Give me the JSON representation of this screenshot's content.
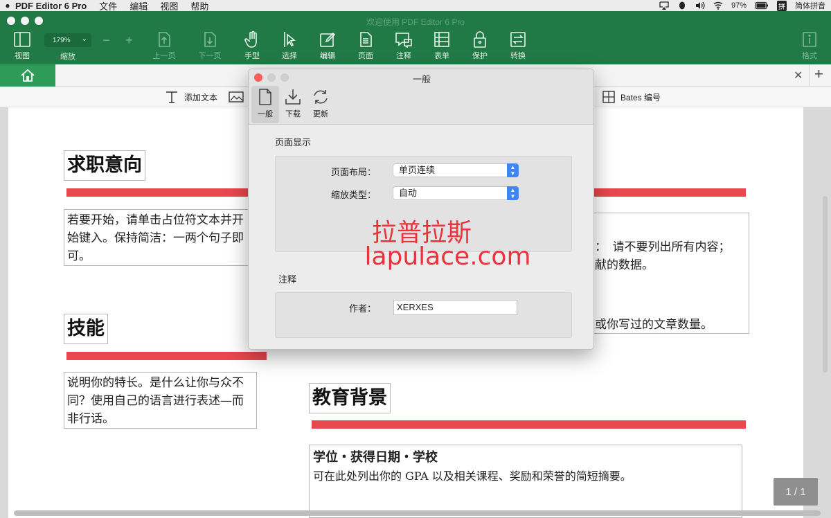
{
  "menubar": {
    "app_name": "PDF Editor 6 Pro",
    "menus": [
      "文件",
      "编辑",
      "视图",
      "帮助"
    ],
    "battery": "97%",
    "input_method": "简体拼音"
  },
  "window": {
    "title": "欢迎使用 PDF Editor 6 Pro"
  },
  "toolbar": {
    "view_label": "视图",
    "zoom_value": "179%",
    "zoom_label": "缩放",
    "zoom_minus": "−",
    "zoom_plus": "+",
    "prev_label": "上一页",
    "next_label": "下一页",
    "hand_label": "手型",
    "select_label": "选择",
    "edit_label": "编辑",
    "page_label": "页面",
    "annotate_label": "注释",
    "form_label": "表单",
    "protect_label": "保护",
    "convert_label": "转换",
    "format_label": "格式"
  },
  "subtoolbar": {
    "add_text": "添加文本",
    "bates": "Bates 编号"
  },
  "document": {
    "job_heading": "求职意向",
    "job_text": "若要开始，请单击占位符文本并开始键入。保持简洁：一两个句子即可。",
    "skills_heading": "技能",
    "skills_text": "说明你的特长。是什么让你与众不同？使用自己的语言进行表述—而非行话。",
    "right_line1": "：　请不要列出所有内容；",
    "right_line2": "献的数据。",
    "right_line3": "或你写过的文章数量。",
    "edu_heading": "教育背景",
    "edu_bold": "学位・获得日期・学校",
    "edu_text": "可在此处列出你的 GPA 以及相关课程、奖励和荣誉的简短摘要。",
    "page_indicator": "1 / 1"
  },
  "dialog": {
    "title": "一般",
    "tabs": [
      "一般",
      "下载",
      "更新"
    ],
    "section_display": "页面显示",
    "layout_label": "页面布局：",
    "layout_value": "单页连续",
    "zoom_type_label": "缩放类型：",
    "zoom_type_value": "自动",
    "section_annot": "注释",
    "author_label": "作者：",
    "author_value": "XERXES",
    "watermark_cn": "拉普拉斯",
    "watermark_url": "lapulace.com"
  },
  "colors": {
    "toolbar_green": "#217a46",
    "home_tab_green": "#2e9b58",
    "accent_red": "#e8474e",
    "select_blue": "#3d86f3"
  }
}
